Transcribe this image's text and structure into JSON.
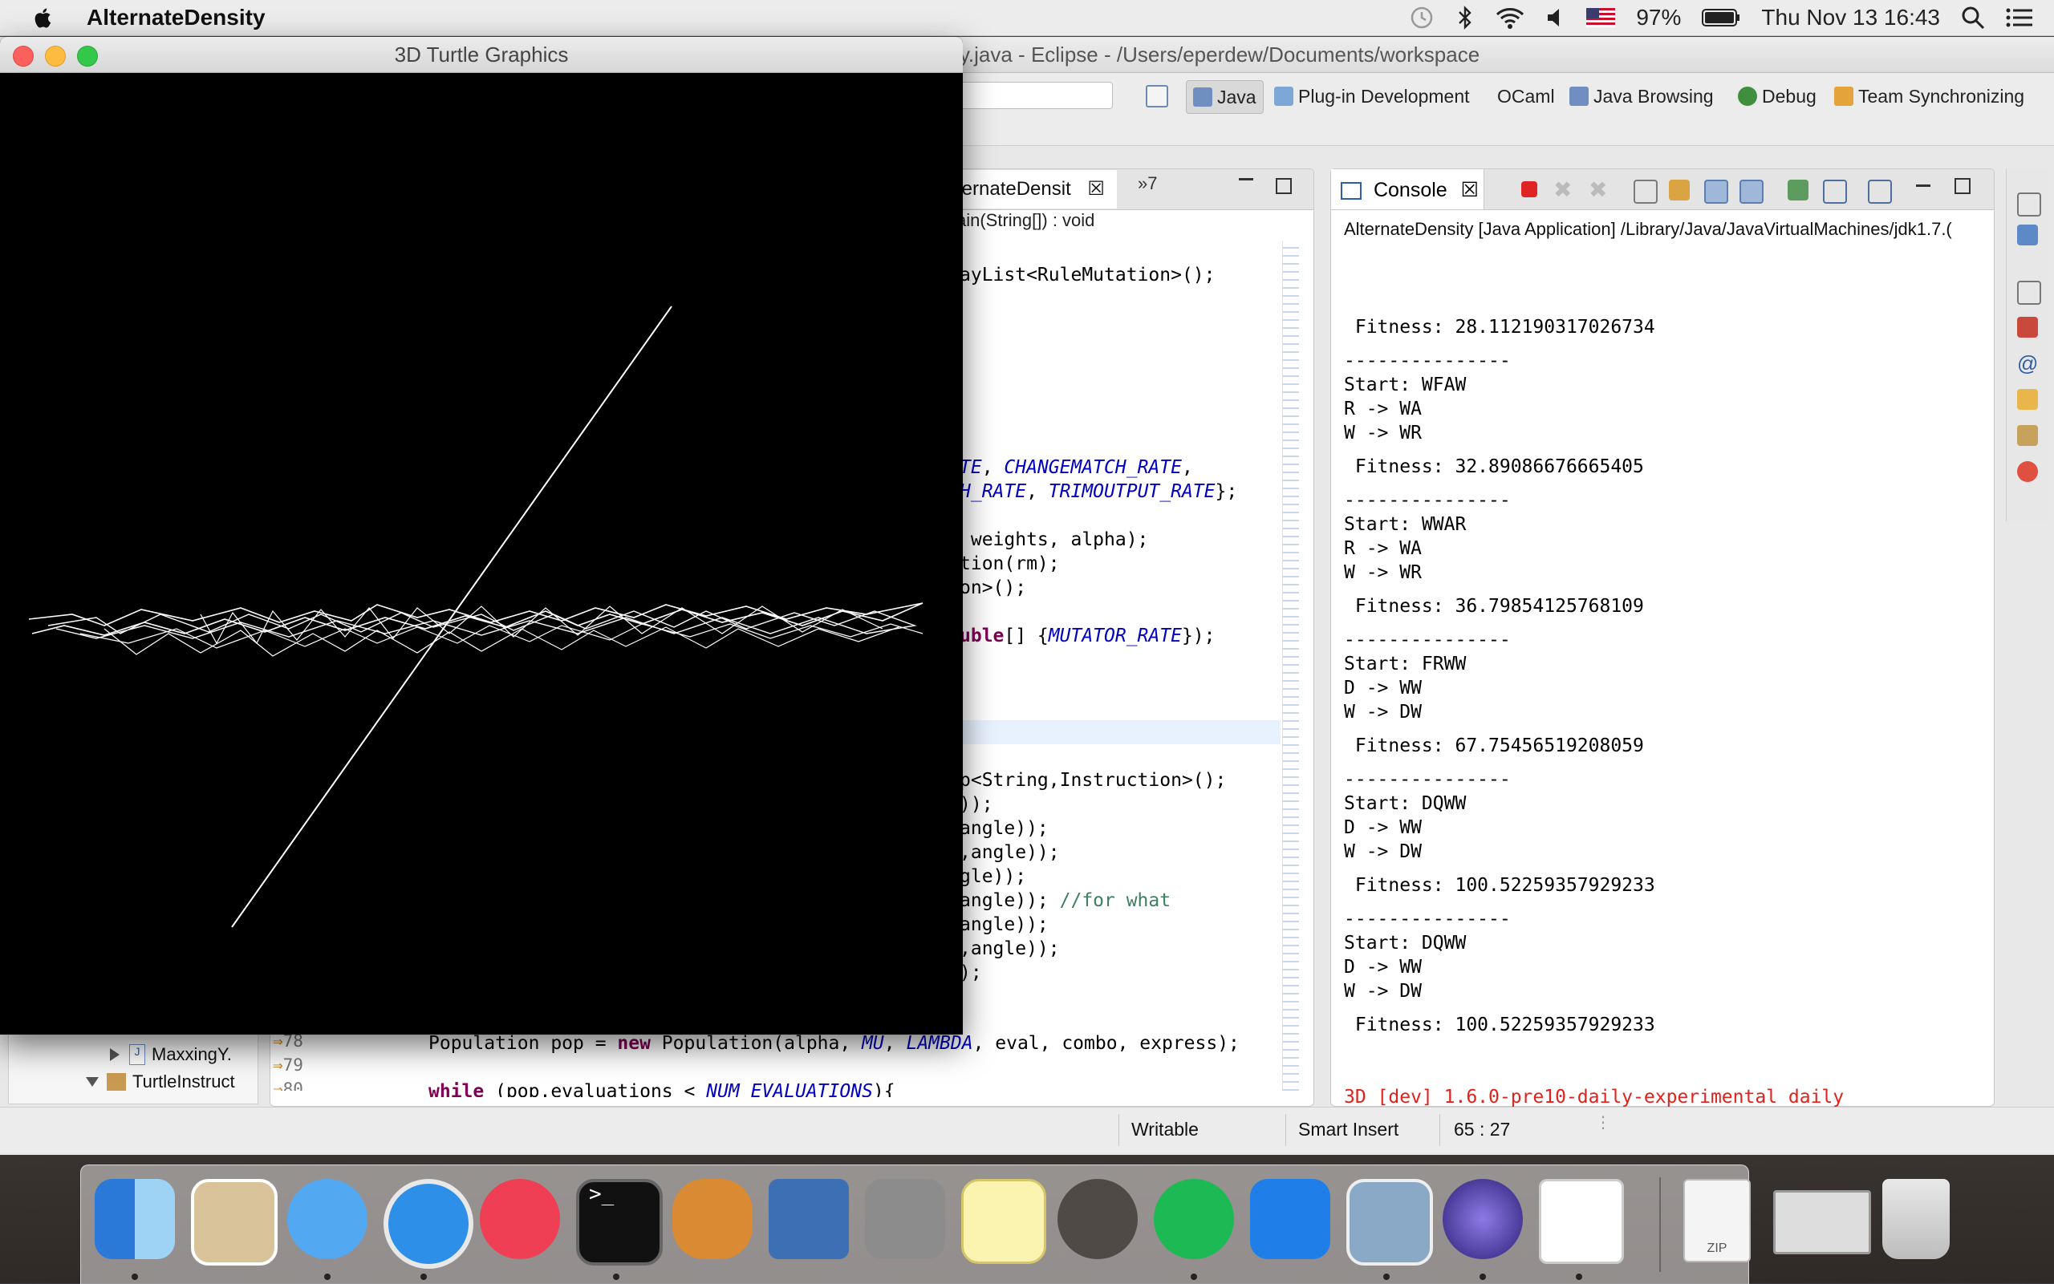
{
  "menubar": {
    "app_name": "AlternateDensity",
    "battery": "97%",
    "datetime": "Thu Nov 13  16:43"
  },
  "eclipse": {
    "title": "y.java - Eclipse - /Users/eperdew/Documents/workspace",
    "perspectives": [
      "Java",
      "Plug-in Development",
      "OCaml",
      "Java Browsing",
      "Debug",
      "Team Synchronizing"
    ],
    "editor": {
      "tab_label": "ternateDensit",
      "overflow_label": "»7",
      "breadcrumb": "ain(String[]) : void",
      "line_numbers": [
        "78",
        "79",
        "80"
      ]
    },
    "console": {
      "tab_label": "Console",
      "description": "AlternateDensity [Java Application] /Library/Java/JavaVirtualMachines/jdk1.7.(",
      "lines": [
        " Fitness: 28.112190317026734",
        "",
        "---------------",
        "Start: WFAW",
        "R -> WA",
        "W -> WR",
        "",
        " Fitness: 32.89086676665405",
        "",
        "---------------",
        "Start: WWAR",
        "R -> WA",
        "W -> WR",
        "",
        " Fitness: 36.79854125768109",
        "",
        "---------------",
        "Start: FRWW",
        "D -> WW",
        "W -> DW",
        "",
        " Fitness: 67.75456519208059",
        "",
        "---------------",
        "Start: DQWW",
        "D -> WW",
        "W -> DW",
        "",
        " Fitness: 100.52259357929233",
        "",
        "---------------",
        "Start: DQWW",
        "D -> WW",
        "W -> DW",
        "",
        " Fitness: 100.52259357929233"
      ],
      "error_line": "3D [dev] 1.6.0-pre10-daily-experimental daily"
    },
    "package_explorer": {
      "items": [
        "MaxxingY.",
        "TurtleInstruct"
      ]
    },
    "status": {
      "writable": "Writable",
      "insert_mode": "Smart Insert",
      "position": "65 : 27"
    }
  },
  "turtle": {
    "title": "3D Turtle Graphics"
  },
  "dock": {
    "apps": [
      "Finder",
      "Mail",
      "Messages",
      "Safari",
      "iTunes",
      "Terminal",
      "GnuCash",
      "VirtualBox",
      "System Preferences",
      "Notes",
      "Cauldron",
      "Spotify",
      "Xcode",
      "Preview",
      "Eclipse",
      "Java",
      "Archive",
      "Screenshot",
      "Trash"
    ],
    "zip_label": "ZIP"
  },
  "colors": {
    "console_error": "#e2211c",
    "keyword": "#7f0055",
    "constant": "#0000c0",
    "comment": "#3f7f5f"
  }
}
